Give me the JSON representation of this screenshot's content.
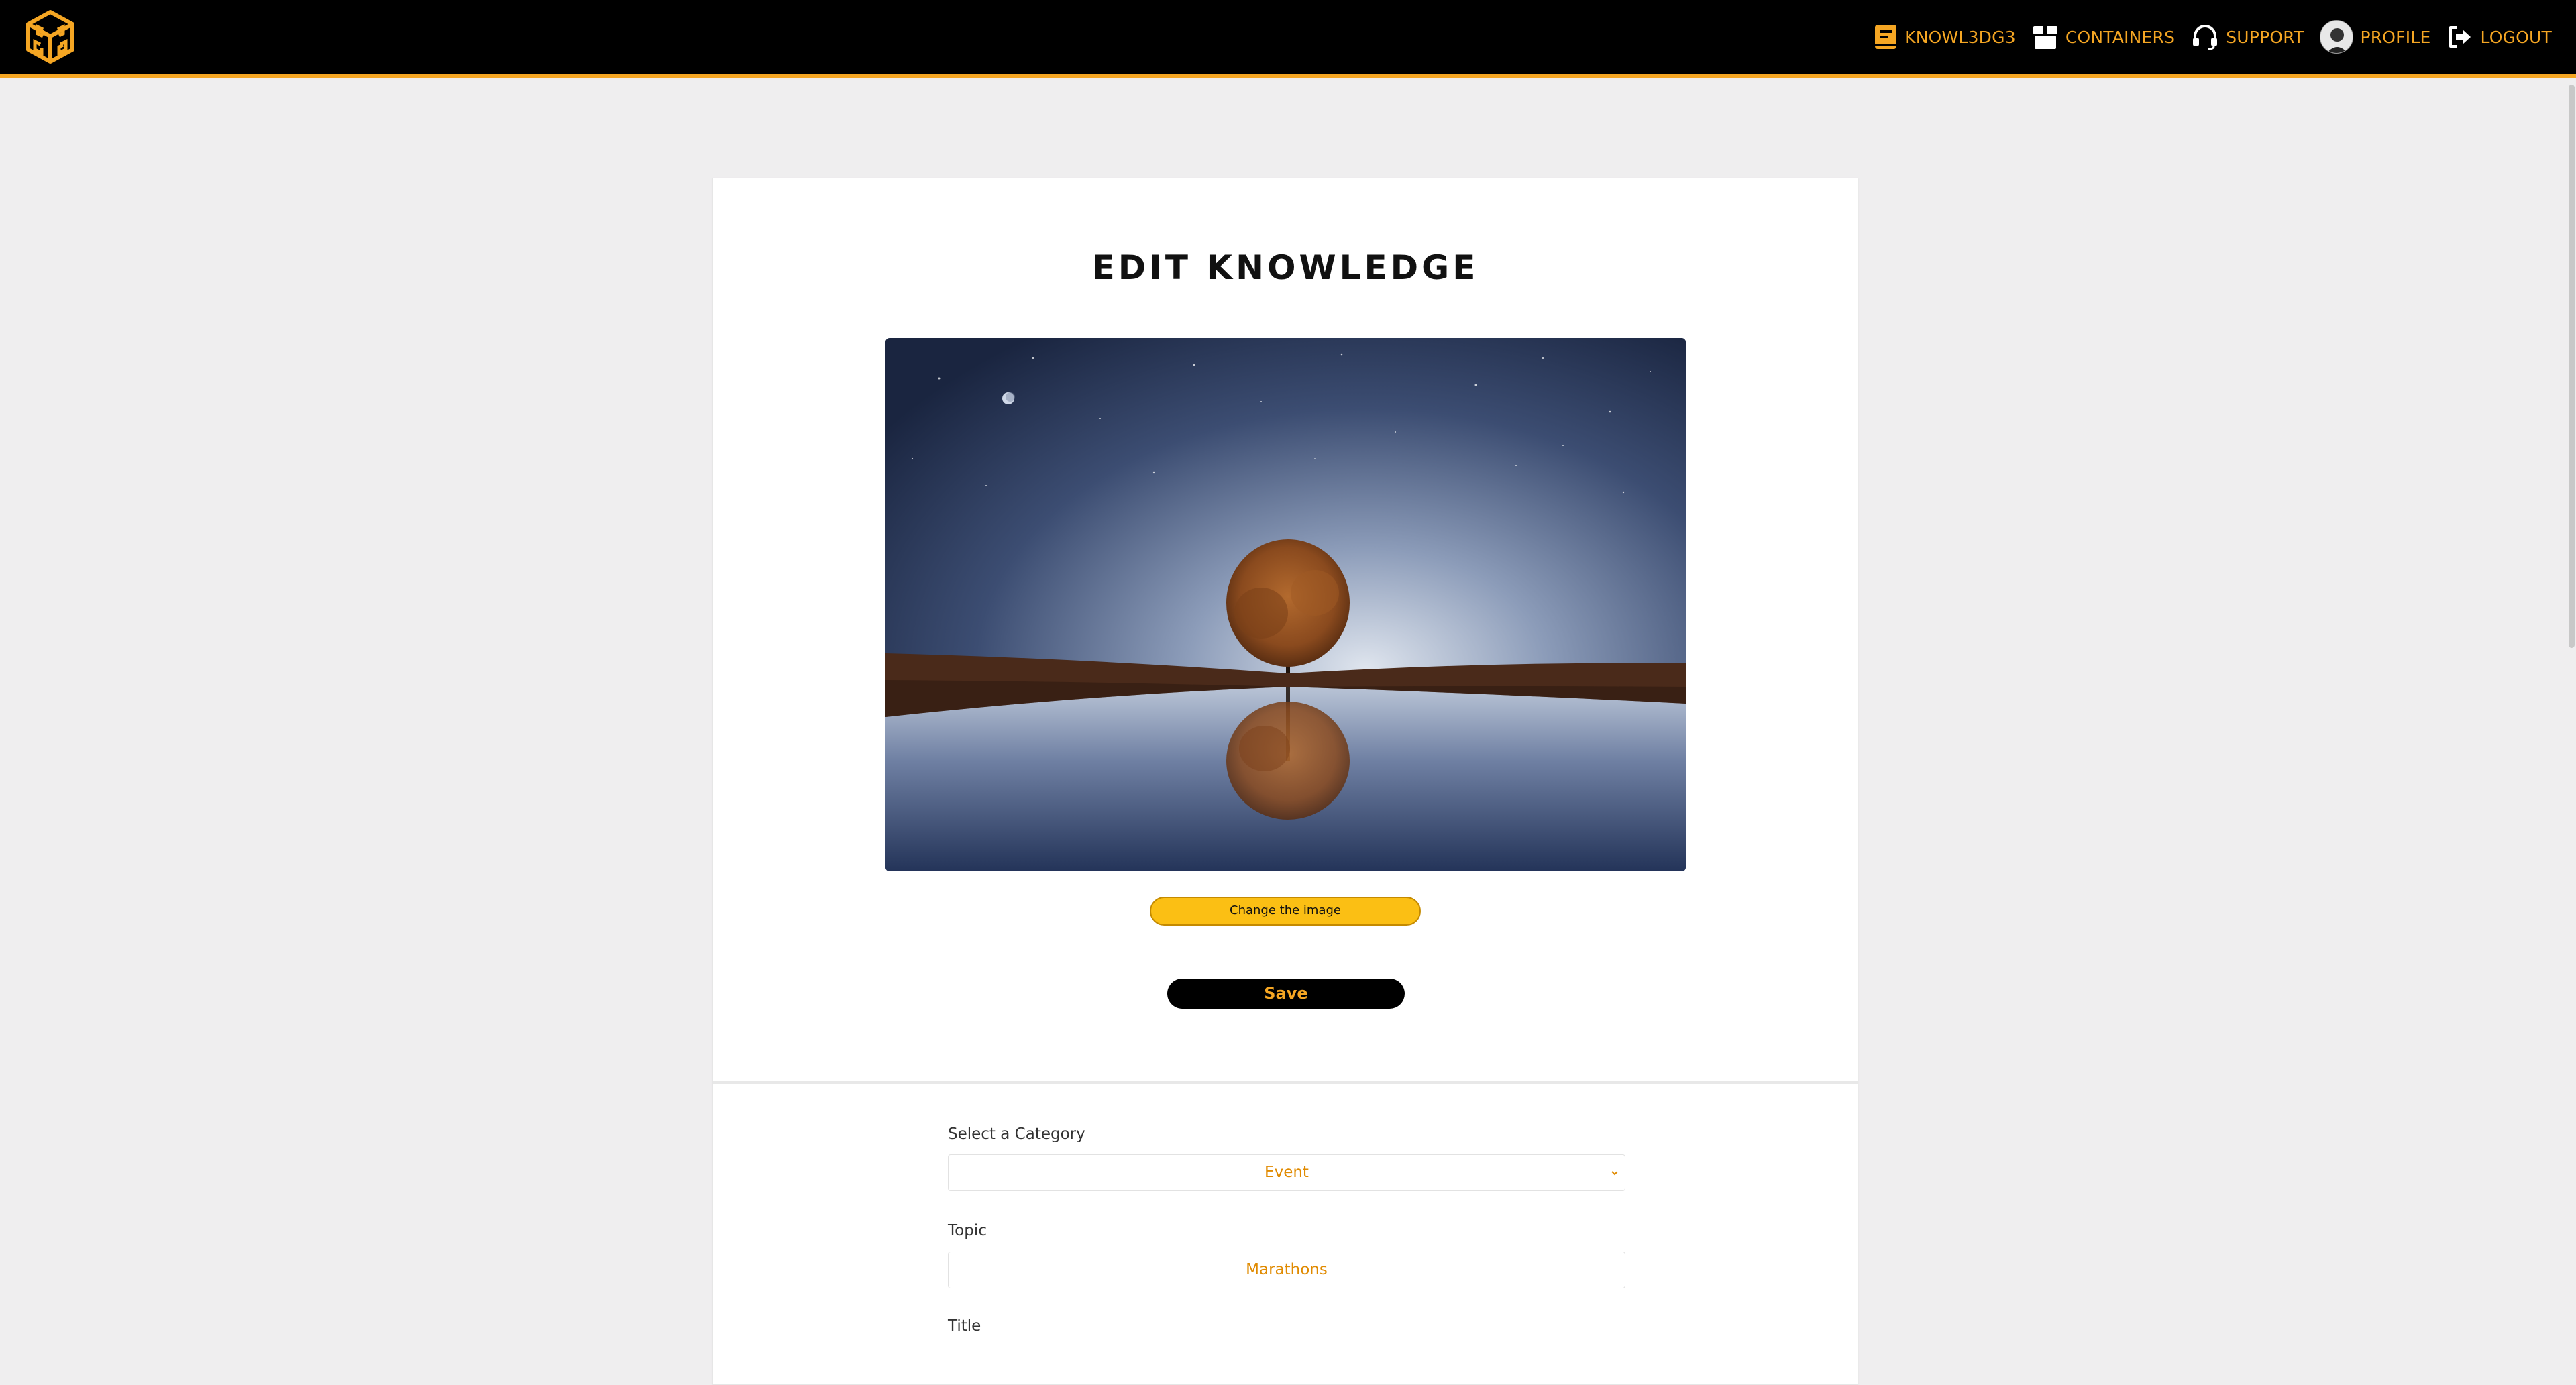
{
  "nav": {
    "logo_icon": "cube-logo-icon",
    "items": [
      {
        "label": "KNOWL3DG3",
        "icon": "book-icon"
      },
      {
        "label": "CONTAINERS",
        "icon": "box-icon"
      },
      {
        "label": "SUPPORT",
        "icon": "headset-icon"
      },
      {
        "label": "PROFILE",
        "icon": "avatar"
      },
      {
        "label": "LOGOUT",
        "icon": "logout-icon"
      }
    ]
  },
  "colors": {
    "accent": "#f5a623",
    "change_button": "#fbbf14",
    "topbar": "#000000",
    "background": "#efeeef"
  },
  "page": {
    "title": "EDIT KNOWLEDGE"
  },
  "image": {
    "description_icon": "tree-reflection-image"
  },
  "buttons": {
    "change_image": "Change the image",
    "save": "Save"
  },
  "form": {
    "category": {
      "label": "Select a Category",
      "value": "Event"
    },
    "topic": {
      "label": "Topic",
      "value": "Marathons"
    },
    "title": {
      "label": "Title"
    }
  }
}
